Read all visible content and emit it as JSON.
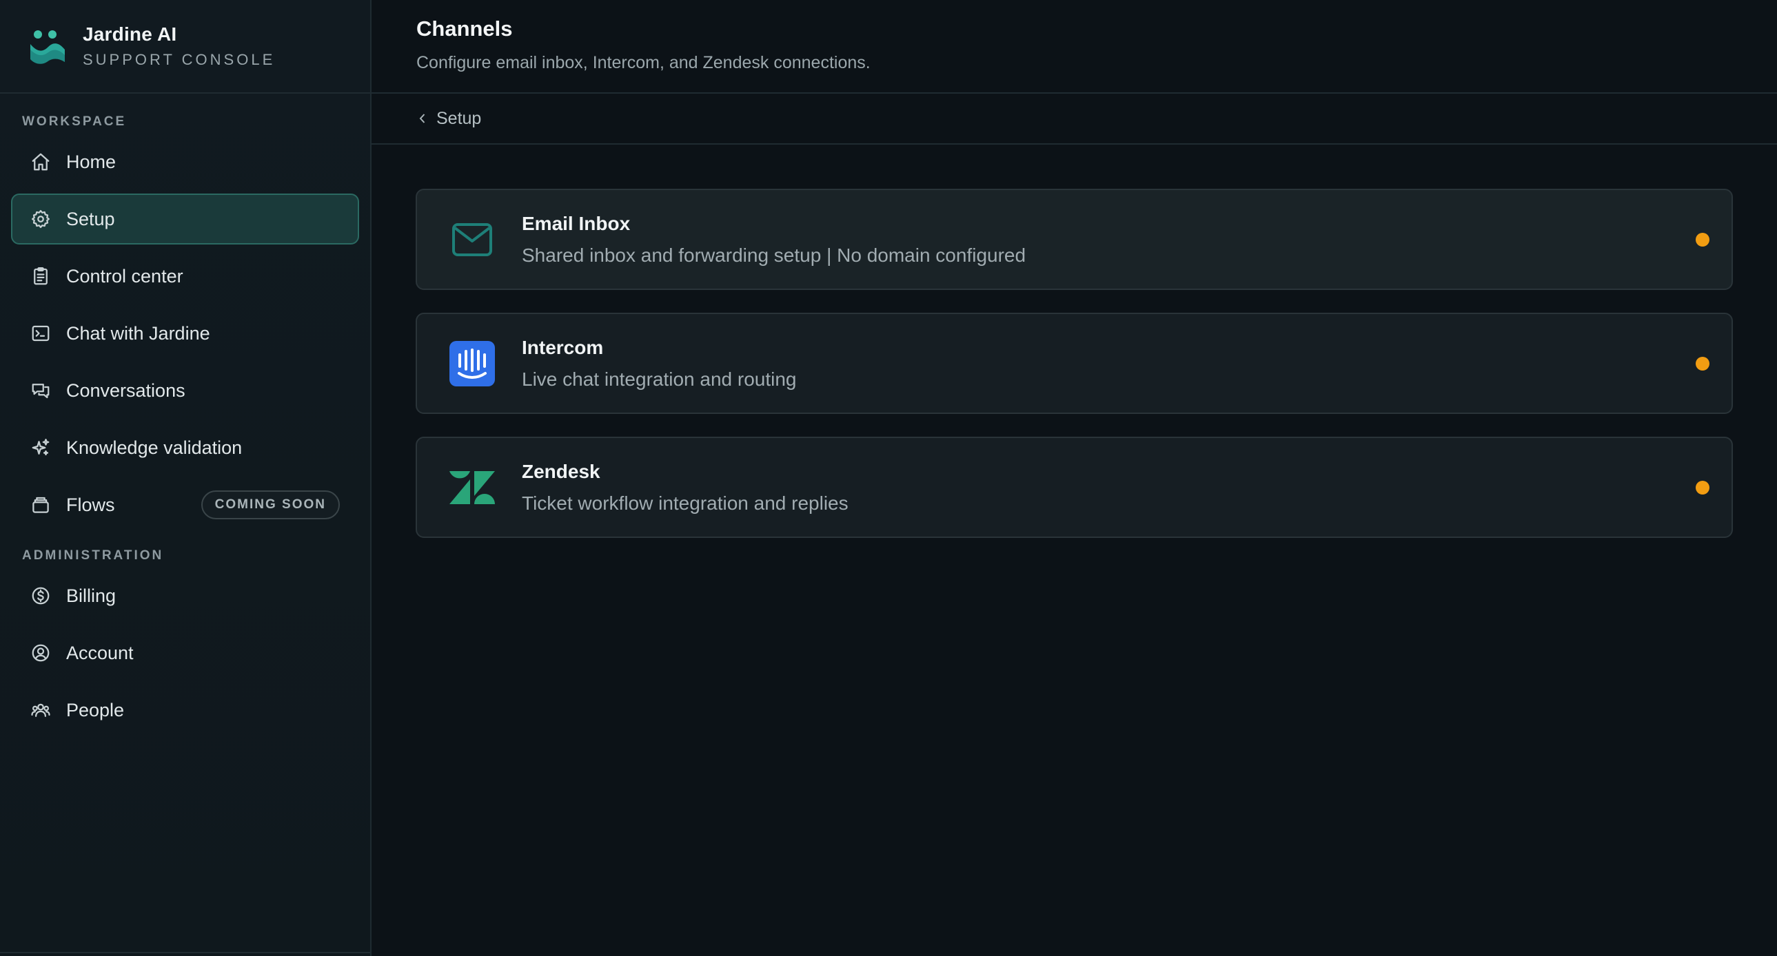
{
  "brand": {
    "name": "Jardine AI",
    "subtitle": "SUPPORT CONSOLE"
  },
  "sidebar": {
    "workspace_label": "WORKSPACE",
    "admin_label": "ADMINISTRATION",
    "workspace_items": [
      {
        "label": "Home",
        "icon": "home-icon"
      },
      {
        "label": "Setup",
        "icon": "gear-icon",
        "active": true
      },
      {
        "label": "Control center",
        "icon": "clipboard-icon"
      },
      {
        "label": "Chat with Jardine",
        "icon": "terminal-icon"
      },
      {
        "label": "Conversations",
        "icon": "chat-bubbles-icon"
      },
      {
        "label": "Knowledge validation",
        "icon": "sparkles-icon"
      },
      {
        "label": "Flows",
        "icon": "layers-icon",
        "badge": "COMING SOON"
      }
    ],
    "admin_items": [
      {
        "label": "Billing",
        "icon": "dollar-circle-icon"
      },
      {
        "label": "Account",
        "icon": "user-circle-icon"
      },
      {
        "label": "People",
        "icon": "users-icon"
      }
    ]
  },
  "header": {
    "title": "Channels",
    "subtitle": "Configure email inbox, Intercom, and Zendesk connections."
  },
  "breadcrumb": {
    "label": "Setup"
  },
  "channels": [
    {
      "title": "Email Inbox",
      "description": "Shared inbox and forwarding setup | No domain configured",
      "icon": "mail-icon"
    },
    {
      "title": "Intercom",
      "description": "Live chat integration and routing",
      "icon": "intercom-logo-icon"
    },
    {
      "title": "Zendesk",
      "description": "Ticket workflow integration and replies",
      "icon": "zendesk-logo-icon"
    }
  ],
  "colors": {
    "accent": "#2b6a62",
    "status_pending": "#f29d12",
    "intercom_blue": "#2f6fe8",
    "zendesk_green": "#2aa579",
    "email_teal": "#1e7f78"
  }
}
